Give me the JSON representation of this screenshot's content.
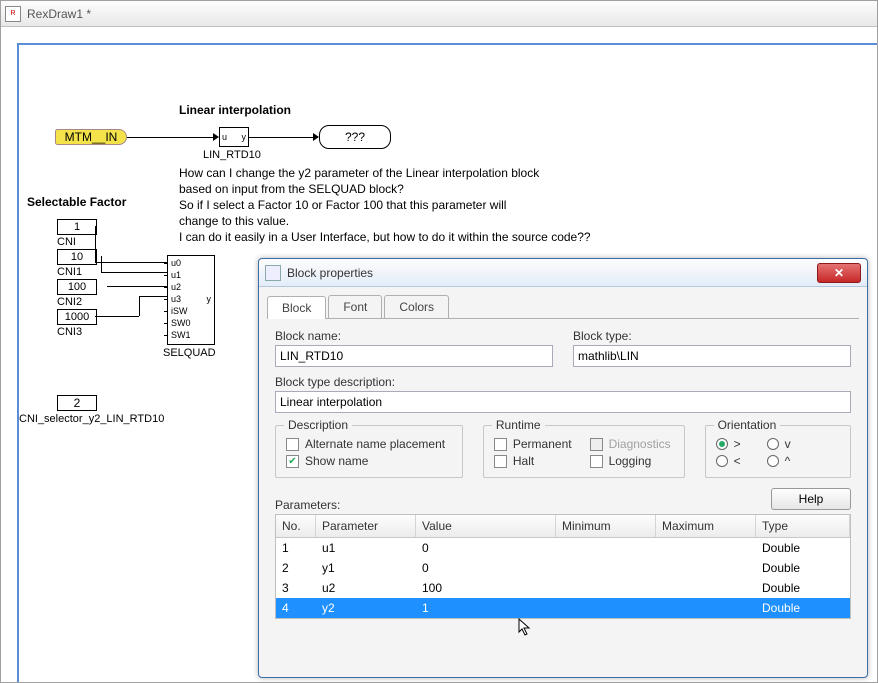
{
  "window": {
    "title": "RexDraw1 *"
  },
  "diagram": {
    "title_linint": "Linear interpolation",
    "title_selfac": "Selectable Factor",
    "mtm_in": "MTM__IN",
    "lin_block": {
      "u": "u",
      "y": "y",
      "name": "LIN_RTD10"
    },
    "out_block": "???",
    "cni": [
      {
        "val": "1",
        "name": "CNI"
      },
      {
        "val": "10",
        "name": "CNI1"
      },
      {
        "val": "100",
        "name": "CNI2"
      },
      {
        "val": "1000",
        "name": "CNI3"
      }
    ],
    "selquad": {
      "ports": [
        "u0",
        "u1",
        "u2",
        "u3",
        "iSW",
        "SW0",
        "SW1"
      ],
      "out": "y",
      "name": "SELQUAD"
    },
    "sel2": {
      "val": "2",
      "name": "CNI_selector_y2_LIN_RTD10"
    },
    "question": [
      "How can I change the y2 parameter of the Linear interpolation block",
      "based on input from the SELQUAD block?",
      "So if I select a Factor 10 or Factor 100 that this parameter will",
      "change to this value.",
      "I can do it easily in a User Interface, but how to do it within the source code??"
    ]
  },
  "dialog": {
    "title": "Block properties",
    "tabs": [
      "Block",
      "Font",
      "Colors"
    ],
    "block_name_label": "Block name:",
    "block_name": "LIN_RTD10",
    "block_type_label": "Block type:",
    "block_type": "mathlib\\LIN",
    "block_desc_label": "Block type description:",
    "block_desc": "Linear interpolation",
    "group_desc": "Description",
    "alt_name": "Alternate name placement",
    "show_name": "Show name",
    "group_runtime": "Runtime",
    "permanent": "Permanent",
    "halt": "Halt",
    "diagnostics": "Diagnostics",
    "logging": "Logging",
    "group_orient": "Orientation",
    "orient": {
      "r": ">",
      "l": "<",
      "d": "v",
      "u": "^"
    },
    "help": "Help",
    "params_label": "Parameters:",
    "columns": {
      "no": "No.",
      "par": "Parameter",
      "val": "Value",
      "min": "Minimum",
      "max": "Maximum",
      "typ": "Type"
    },
    "rows": [
      {
        "no": "1",
        "par": "u1",
        "val": "0",
        "min": "",
        "max": "",
        "typ": "Double",
        "sel": false
      },
      {
        "no": "2",
        "par": "y1",
        "val": "0",
        "min": "",
        "max": "",
        "typ": "Double",
        "sel": false
      },
      {
        "no": "3",
        "par": "u2",
        "val": "100",
        "min": "",
        "max": "",
        "typ": "Double",
        "sel": false
      },
      {
        "no": "4",
        "par": "y2",
        "val": "1",
        "min": "",
        "max": "",
        "typ": "Double",
        "sel": true
      }
    ]
  }
}
